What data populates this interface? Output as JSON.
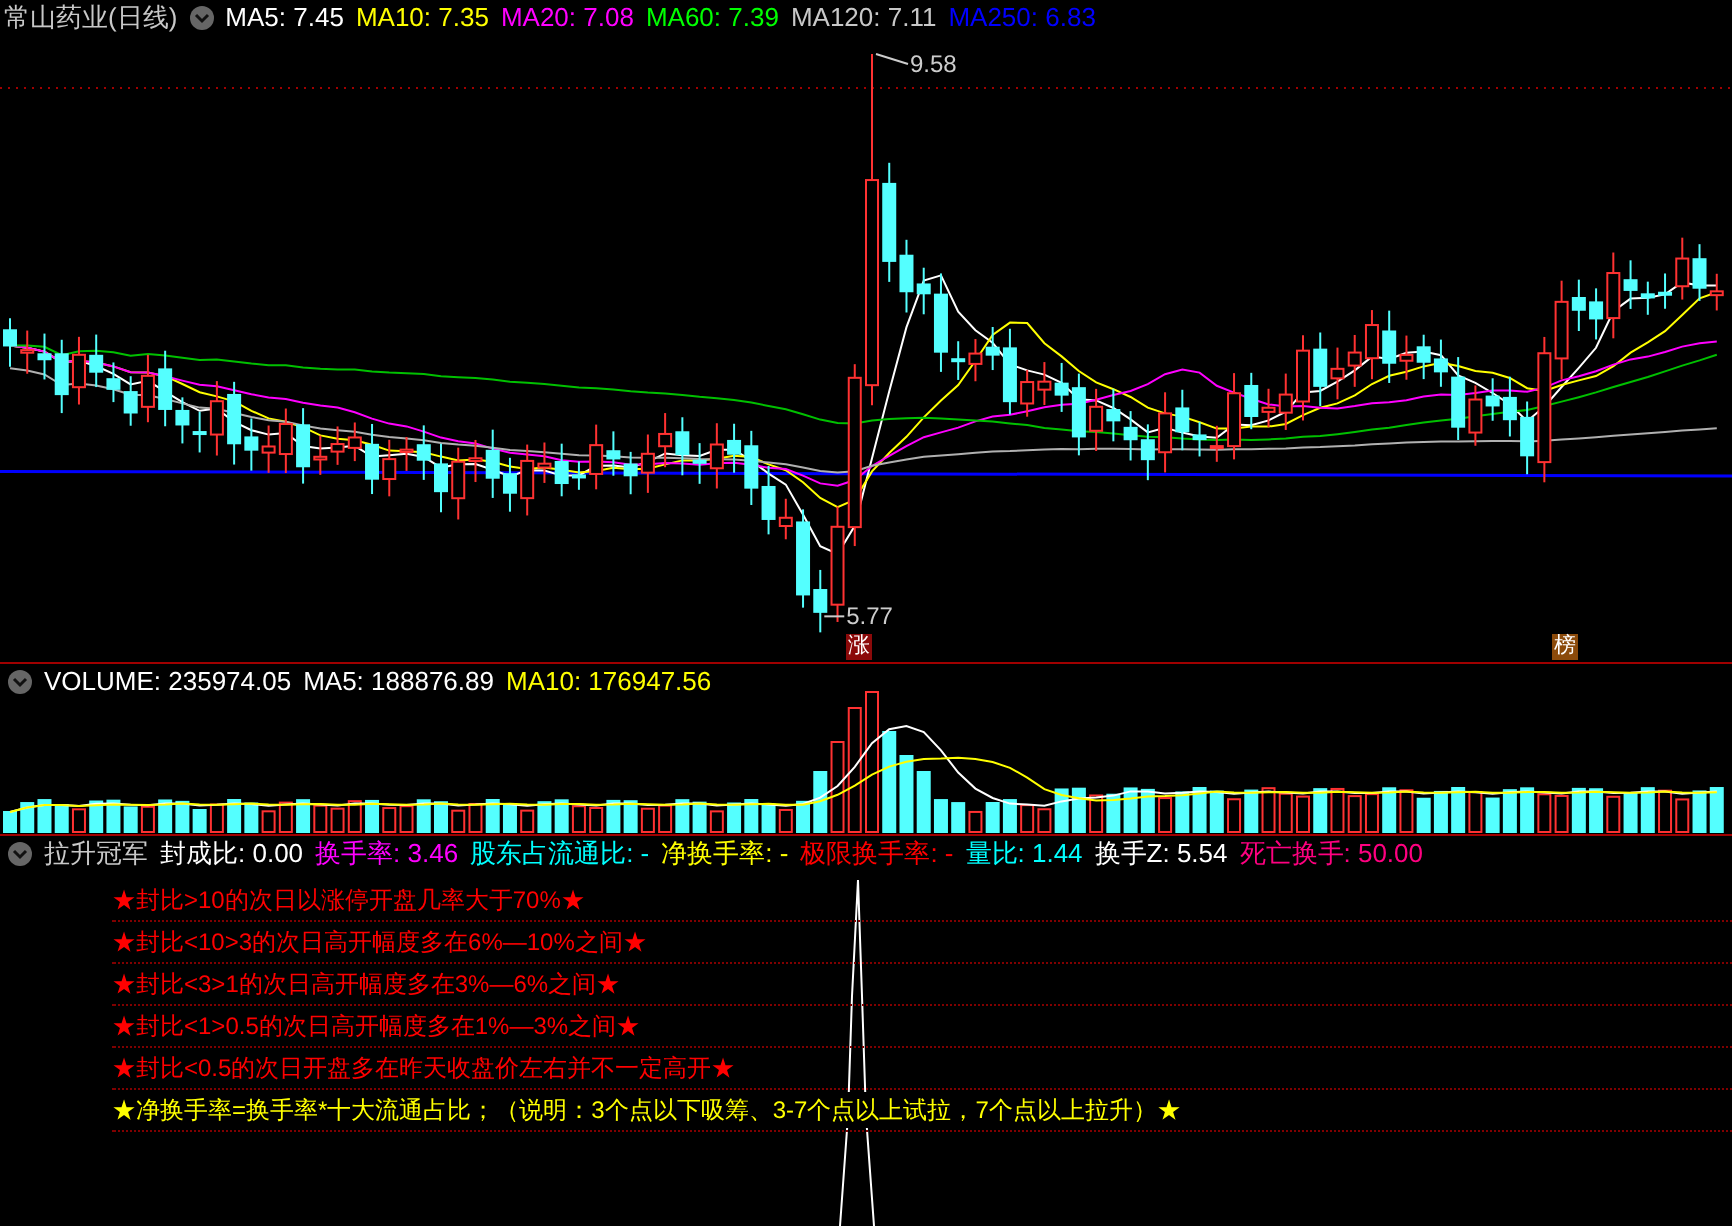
{
  "main_panel": {
    "title": "常山药业(日线)",
    "indicators": [
      {
        "text": "MA5: 7.45",
        "color": "#ffffff"
      },
      {
        "text": "MA10: 7.35",
        "color": "#ffff00"
      },
      {
        "text": "MA20: 7.08",
        "color": "#ff00ff"
      },
      {
        "text": "MA60: 7.39",
        "color": "#00ff00"
      },
      {
        "text": "MA120: 7.11",
        "color": "#c8c8c8"
      },
      {
        "text": "MA250: 6.83",
        "color": "#0000ff"
      }
    ],
    "high_label": "9.58",
    "low_label": "5.77",
    "badges": [
      {
        "text": "涨",
        "color": "#8b0a0a"
      },
      {
        "text": "榜",
        "color": "#8b4a0a"
      }
    ]
  },
  "volume_panel": {
    "indicators": [
      {
        "text": "VOLUME: 235974.05",
        "color": "#ffffff"
      },
      {
        "text": "MA5: 188876.89",
        "color": "#ffffff"
      },
      {
        "text": "MA10: 176947.56",
        "color": "#ffff00"
      }
    ]
  },
  "indicator_panel": {
    "title": "拉升冠军",
    "indicators": [
      {
        "text": "封成比: 0.00",
        "color": "#ffffff"
      },
      {
        "text": "换手率: 3.46",
        "color": "#ff00ff"
      },
      {
        "text": "股东占流通比: -",
        "color": "#00ffff"
      },
      {
        "text": "净换手率: -",
        "color": "#ffff00"
      },
      {
        "text": "极限换手率: -",
        "color": "#ff0000"
      },
      {
        "text": "量比: 1.44",
        "color": "#00ffff"
      },
      {
        "text": "换手Z: 5.54",
        "color": "#ffffff"
      },
      {
        "text": "死亡换手: 50.00",
        "color": "#ff0080"
      }
    ],
    "notes": [
      {
        "text": "★封比>10的次日以涨停开盘几率大于70%★",
        "color": "#ff0000"
      },
      {
        "text": "★封比<10>3的次日高开幅度多在6%—10%之间★",
        "color": "#ff0000"
      },
      {
        "text": "★封比<3>1的次日高开幅度多在3%—6%之间★",
        "color": "#ff0000"
      },
      {
        "text": "★封比<1>0.5的次日高开幅度多在1%—3%之间★",
        "color": "#ff0000"
      },
      {
        "text": "★封比<0.5的次日开盘多在昨天收盘价左右并不一定高开★",
        "color": "#ff0000"
      },
      {
        "text": "★净换手率=换手率*十大流通占比；（说明：3个点以下吸筹、3-7个点以上试拉，7个点以上拉升）★",
        "color": "#ffff00"
      }
    ]
  }
}
